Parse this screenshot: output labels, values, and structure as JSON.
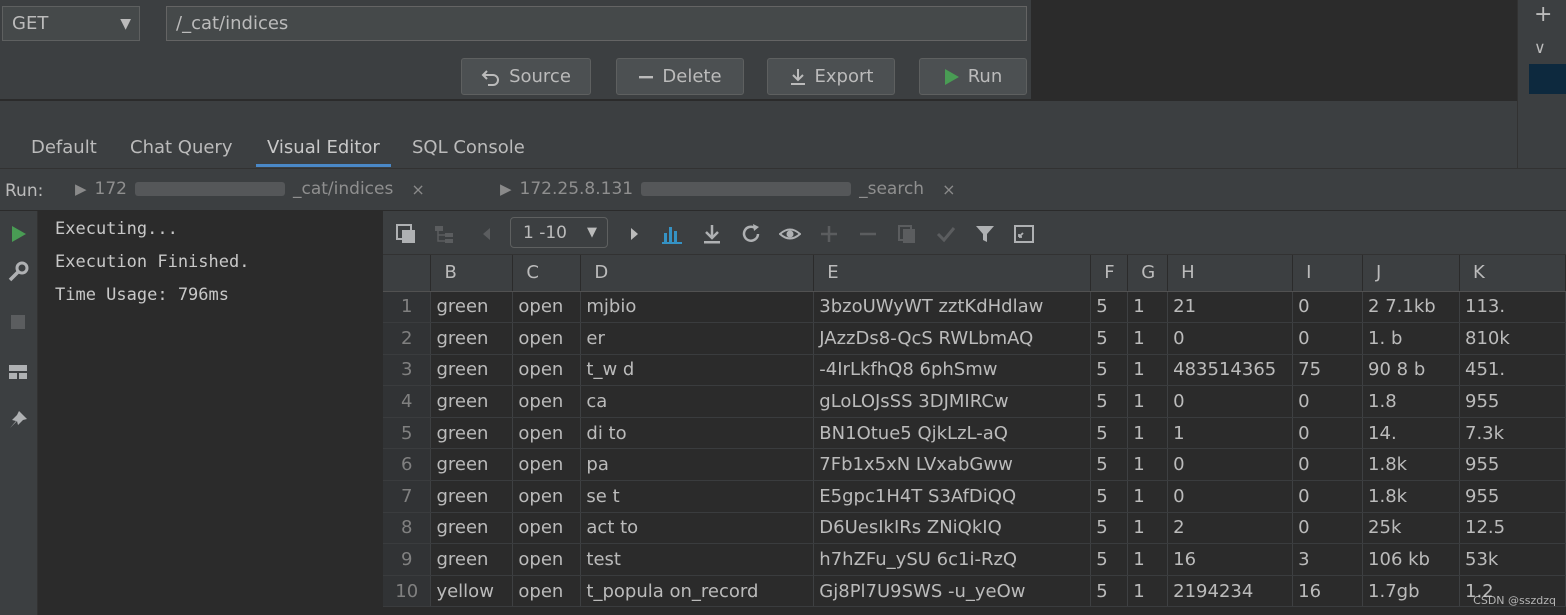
{
  "request": {
    "method": "GET",
    "url": "/_cat/indices",
    "buttons": {
      "source": "Source",
      "delete": "Delete",
      "export": "Export",
      "run": "Run"
    }
  },
  "editor_tabs": [
    "Default",
    "Chat Query",
    "Visual Editor",
    "SQL Console"
  ],
  "active_editor_tab": "Visual Editor",
  "run_bar": {
    "label": "Run:",
    "tabs": [
      {
        "prefix": "172",
        "mid": "_cat/indices"
      },
      {
        "prefix": "172.25.8.131",
        "mid": "_search"
      }
    ]
  },
  "console": {
    "lines": [
      "Executing...",
      "Execution Finished.",
      "Time Usage: 796ms"
    ]
  },
  "result_toolbar": {
    "pager": "1 -10"
  },
  "table": {
    "columns": [
      "B",
      "C",
      "D",
      "E",
      "F",
      "G",
      "H",
      "I",
      "J",
      "K"
    ],
    "rows": [
      [
        "1",
        "green",
        "open",
        "mjbio",
        "3bzoUWyWT zztKdHdlaw",
        "5",
        "1",
        "21",
        "0",
        "2 7.1kb",
        "113."
      ],
      [
        "2",
        "green",
        "open",
        "er",
        "JAzzDs8-QcS RWLbmAQ",
        "5",
        "1",
        "0",
        "0",
        "1. b",
        "810k"
      ],
      [
        "3",
        "green",
        "open",
        "t_w d",
        "-4IrLkfhQ8 6phSmw",
        "5",
        "1",
        "483514365",
        "75",
        "90 8 b",
        "451."
      ],
      [
        "4",
        "green",
        "open",
        "ca",
        "gLoLOJsSS 3DJMIRCw",
        "5",
        "1",
        "0",
        "0",
        "1.8",
        "955"
      ],
      [
        "5",
        "green",
        "open",
        "di to",
        "BN1Otue5 QjkLzL-aQ",
        "5",
        "1",
        "1",
        "0",
        "14.",
        "7.3k"
      ],
      [
        "6",
        "green",
        "open",
        "pa",
        "7Fb1x5xN LVxabGww",
        "5",
        "1",
        "0",
        "0",
        "1.8k",
        "955"
      ],
      [
        "7",
        "green",
        "open",
        "se t",
        "E5gpc1H4T S3AfDiQQ",
        "5",
        "1",
        "0",
        "0",
        "1.8k",
        "955"
      ],
      [
        "8",
        "green",
        "open",
        "act to",
        "D6UesIkIRs ZNiQkIQ",
        "5",
        "1",
        "2",
        "0",
        "25k",
        "12.5"
      ],
      [
        "9",
        "green",
        "open",
        "test",
        "h7hZFu_ySU 6c1i-RzQ",
        "5",
        "1",
        "16",
        "3",
        "106 kb",
        "53k"
      ],
      [
        "10",
        "yellow",
        "open",
        "t_popula on_record",
        "Gj8Pl7U9SWS -u_yeOw",
        "5",
        "1",
        "2194234",
        "16",
        "1.7gb",
        "1.2"
      ]
    ]
  },
  "watermark": "CSDN @sszdzq",
  "colors": {
    "accent": "#4a88c7",
    "run_green": "#499c54",
    "chart_icon_blue": "#3592c4"
  }
}
